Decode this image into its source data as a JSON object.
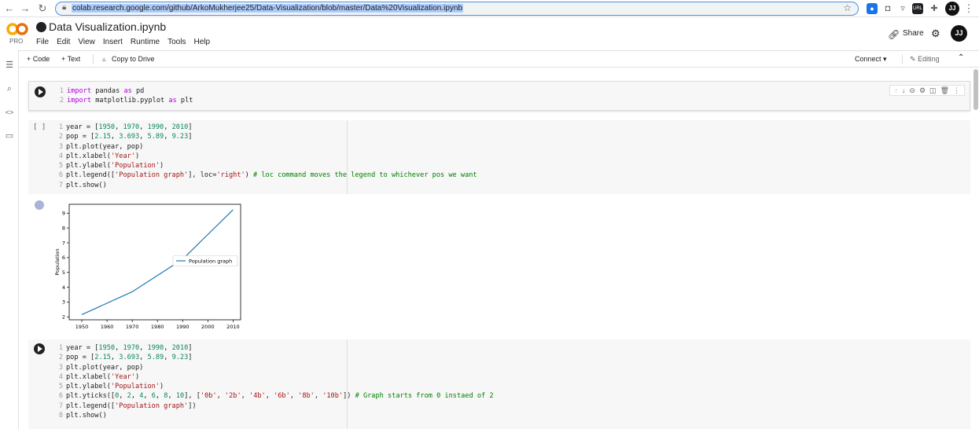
{
  "browser": {
    "url": "colab.research.google.com/github/ArkoMukherjee25/Data-Visualization/blob/master/Data%20Visualization.ipynb",
    "profile_initials": "JJ"
  },
  "app": {
    "logo_text": "CO",
    "logo_badge": "PRO",
    "title": "Data Visualization.ipynb",
    "menu": [
      "File",
      "Edit",
      "View",
      "Insert",
      "Runtime",
      "Tools",
      "Help"
    ],
    "share": "Share",
    "avatar_initials": "JJ"
  },
  "toolbar": {
    "add_code": "+ Code",
    "add_text": "+ Text",
    "copy_to_drive": "Copy to Drive",
    "connect": "Connect",
    "editing": "Editing"
  },
  "cells": {
    "c1": {
      "lines": [
        [
          {
            "t": "import",
            "c": "kw"
          },
          {
            "t": " pandas "
          },
          {
            "t": "as",
            "c": "kw"
          },
          {
            "t": " pd"
          }
        ],
        [
          {
            "t": "import",
            "c": "kw"
          },
          {
            "t": " matplotlib.pyplot "
          },
          {
            "t": "as",
            "c": "kw"
          },
          {
            "t": " plt"
          }
        ]
      ]
    },
    "c2": {
      "exec_label": "[ ]",
      "lines": [
        [
          {
            "t": "year = ["
          },
          {
            "t": "1950",
            "c": "num"
          },
          {
            "t": ", "
          },
          {
            "t": "1970",
            "c": "num"
          },
          {
            "t": ", "
          },
          {
            "t": "1990",
            "c": "num"
          },
          {
            "t": ", "
          },
          {
            "t": "2010",
            "c": "num"
          },
          {
            "t": "]"
          }
        ],
        [
          {
            "t": "pop = ["
          },
          {
            "t": "2.15",
            "c": "num"
          },
          {
            "t": ", "
          },
          {
            "t": "3.693",
            "c": "num"
          },
          {
            "t": ", "
          },
          {
            "t": "5.89",
            "c": "num"
          },
          {
            "t": ", "
          },
          {
            "t": "9.23",
            "c": "num"
          },
          {
            "t": "]"
          }
        ],
        [
          {
            "t": "plt.plot(year, pop)"
          }
        ],
        [
          {
            "t": "plt.xlabel("
          },
          {
            "t": "'Year'",
            "c": "str"
          },
          {
            "t": ")"
          }
        ],
        [
          {
            "t": "plt.ylabel("
          },
          {
            "t": "'Population'",
            "c": "str"
          },
          {
            "t": ")"
          }
        ],
        [
          {
            "t": "plt.legend(["
          },
          {
            "t": "'Population graph'",
            "c": "str"
          },
          {
            "t": "], loc="
          },
          {
            "t": "'right'",
            "c": "str"
          },
          {
            "t": ") "
          },
          {
            "t": "# loc command moves the legend to whichever pos we want",
            "c": "cmt"
          }
        ],
        [
          {
            "t": "plt.show()"
          }
        ]
      ]
    },
    "c3": {
      "lines": [
        [
          {
            "t": "year = ["
          },
          {
            "t": "1950",
            "c": "num"
          },
          {
            "t": ", "
          },
          {
            "t": "1970",
            "c": "num"
          },
          {
            "t": ", "
          },
          {
            "t": "1990",
            "c": "num"
          },
          {
            "t": ", "
          },
          {
            "t": "2010",
            "c": "num"
          },
          {
            "t": "]"
          }
        ],
        [
          {
            "t": "pop = ["
          },
          {
            "t": "2.15",
            "c": "num"
          },
          {
            "t": ", "
          },
          {
            "t": "3.693",
            "c": "num"
          },
          {
            "t": ", "
          },
          {
            "t": "5.89",
            "c": "num"
          },
          {
            "t": ", "
          },
          {
            "t": "9.23",
            "c": "num"
          },
          {
            "t": "]"
          }
        ],
        [
          {
            "t": "plt.plot(year, pop)"
          }
        ],
        [
          {
            "t": "plt.xlabel("
          },
          {
            "t": "'Year'",
            "c": "str"
          },
          {
            "t": ")"
          }
        ],
        [
          {
            "t": "plt.ylabel("
          },
          {
            "t": "'Population'",
            "c": "str"
          },
          {
            "t": ")"
          }
        ],
        [
          {
            "t": "plt.yticks(["
          },
          {
            "t": "0",
            "c": "num"
          },
          {
            "t": ", "
          },
          {
            "t": "2",
            "c": "num"
          },
          {
            "t": ", "
          },
          {
            "t": "4",
            "c": "num"
          },
          {
            "t": ", "
          },
          {
            "t": "6",
            "c": "num"
          },
          {
            "t": ", "
          },
          {
            "t": "8",
            "c": "num"
          },
          {
            "t": ", "
          },
          {
            "t": "10",
            "c": "num"
          },
          {
            "t": "], ["
          },
          {
            "t": "'0b'",
            "c": "str"
          },
          {
            "t": ", "
          },
          {
            "t": "'2b'",
            "c": "str"
          },
          {
            "t": ", "
          },
          {
            "t": "'4b'",
            "c": "str"
          },
          {
            "t": ", "
          },
          {
            "t": "'6b'",
            "c": "str"
          },
          {
            "t": ", "
          },
          {
            "t": "'8b'",
            "c": "str"
          },
          {
            "t": ", "
          },
          {
            "t": "'10b'",
            "c": "str"
          },
          {
            "t": "]) "
          },
          {
            "t": "# Graph starts from 0 instaed of 2",
            "c": "cmt"
          }
        ],
        [
          {
            "t": "plt.legend(["
          },
          {
            "t": "'Population graph'",
            "c": "str"
          },
          {
            "t": "])"
          }
        ],
        [
          {
            "t": "plt.show()"
          }
        ]
      ]
    }
  },
  "chart_data": {
    "type": "line",
    "x": [
      1950,
      1970,
      1990,
      2010
    ],
    "series": [
      {
        "name": "Population graph",
        "values": [
          2.15,
          3.693,
          5.89,
          9.23
        ]
      }
    ],
    "xlabel": "",
    "ylabel": "Population",
    "xlim": [
      1945,
      2013
    ],
    "ylim": [
      1.8,
      9.6
    ],
    "xticks": [
      1950,
      1960,
      1970,
      1980,
      1990,
      2000,
      2010
    ],
    "yticks": [
      2,
      3,
      4,
      5,
      6,
      7,
      8,
      9
    ],
    "legend": "right",
    "grid": false,
    "color": "#1f77b4"
  }
}
